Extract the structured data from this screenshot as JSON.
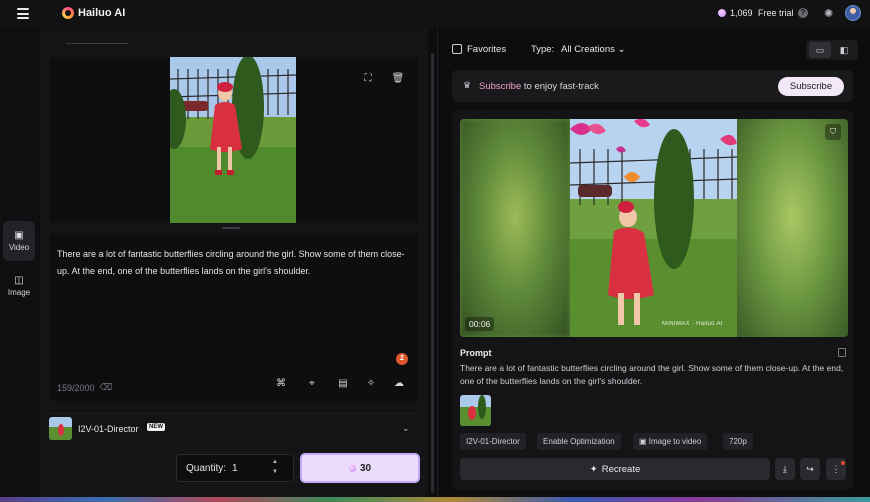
{
  "app": {
    "logo_text": "Hailuo AI",
    "credits": "1,069",
    "free_trial": "Free trial",
    "help_glyph": "?"
  },
  "rail": {
    "video_label": "Video",
    "image_label": "Image"
  },
  "editor": {
    "prompt_text": "There are a lot of fantastic butterflies circling around the girl. Show some of them close-up. At the end, one of the butterflies lands on the girl's shoulder.",
    "char_count": "159/2000",
    "notification_count": "2",
    "model_name": "I2V-01-Director",
    "new_badge": "NEW",
    "quantity_label": "Quantity:",
    "quantity_value": "1",
    "generate_cost": "30"
  },
  "feed": {
    "favorites_label": "Favorites",
    "type_label": "Type:",
    "type_value": "All Creations",
    "subscribe_highlight": "Subscribe",
    "subscribe_rest": "to enjoy fast-track",
    "subscribe_button": "Subscribe",
    "video_time": "00:06",
    "watermark": "MINIMAX · Hailuo AI",
    "prompt_heading": "Prompt",
    "prompt_text": "There are a lot of fantastic butterflies circling around the girl. Show some of them close-up. At the end, one of the butterflies lands on the girl's shoulder.",
    "tags": [
      "I2V-01-Director",
      "Enable Optimization",
      "Image to video",
      "720p"
    ],
    "recreate_label": "Recreate"
  },
  "icons": {
    "menu": "hamburger-icon",
    "image_edit": "image-icon",
    "delete": "trash-icon",
    "bookmark": "bookmark-icon",
    "download": "download-icon",
    "share": "share-icon",
    "more": "more-vertical-icon"
  },
  "colors": {
    "accent_button": "#e9ddfb",
    "subscribe_highlight": "#f0a0c8",
    "badge": "#e0582c"
  }
}
